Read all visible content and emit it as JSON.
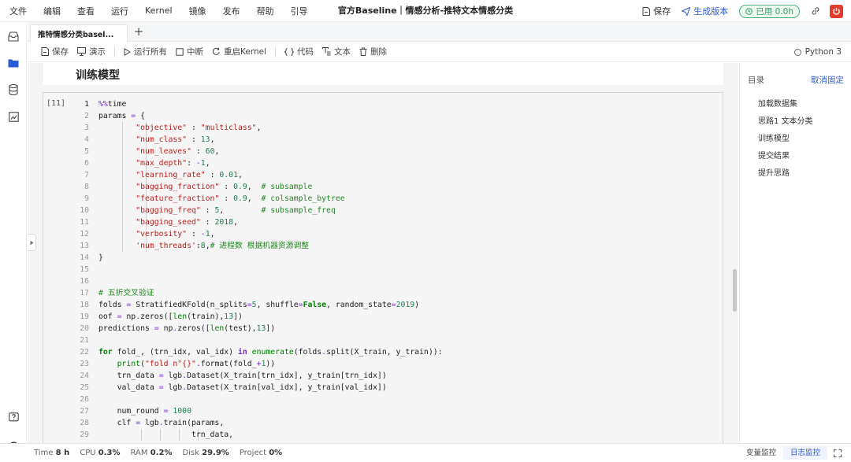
{
  "menubar": {
    "items": [
      "文件",
      "编辑",
      "查看",
      "运行",
      "Kernel",
      "镜像",
      "发布",
      "帮助",
      "引导"
    ],
    "title": "官方Baseline｜情感分析-推特文本情感分类",
    "save": "保存",
    "generate_version": "生成版本",
    "usage": "已用 0.0h",
    "accent": "#2a5bd7",
    "power_color": "#e33d2e"
  },
  "tabs": {
    "file_tab": "推特情感分类basel...",
    "add_label": "+"
  },
  "toolbar": {
    "save": "保存",
    "present": "演示",
    "run_all": "运行所有",
    "interrupt": "中断",
    "restart_kernel": "重启Kernel",
    "code": "代码",
    "text": "文本",
    "delete": "删除",
    "kernel": "Python 3"
  },
  "notebook": {
    "section_heading": "训练模型",
    "cell_exec_count": "[11]",
    "line_numbers": [
      "1",
      "2",
      "3",
      "4",
      "5",
      "6",
      "7",
      "8",
      "9",
      "10",
      "11",
      "12",
      "13",
      "14",
      "15",
      "16",
      "17",
      "18",
      "19",
      "20",
      "21",
      "22",
      "23",
      "24",
      "25",
      "26",
      "27",
      "28",
      "29"
    ]
  },
  "toc": {
    "title": "目录",
    "unpin": "取消固定",
    "items": [
      "加载数据集",
      "思路1 文本分类",
      "训练模型",
      "提交结果",
      "提升思路"
    ]
  },
  "status": {
    "time_label": "Time",
    "time_value": "8 h",
    "cpu_label": "CPU",
    "cpu_value": "0.3%",
    "ram_label": "RAM",
    "ram_value": "0.2%",
    "disk_label": "Disk",
    "disk_value": "29.9%",
    "project_label": "Project",
    "project_value": "0%",
    "var_monitor": "变量监控",
    "log_monitor": "日志监控"
  }
}
